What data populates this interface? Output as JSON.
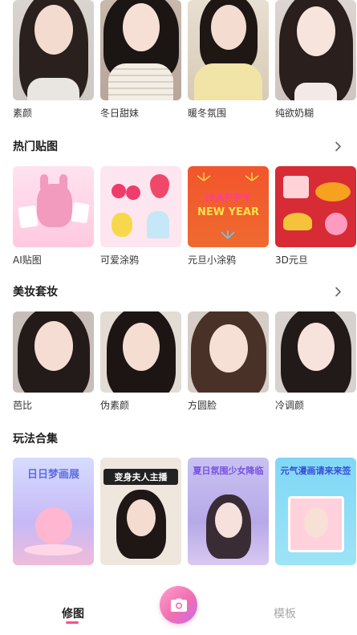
{
  "top_row": {
    "items": [
      {
        "label": "素颜"
      },
      {
        "label": "冬日甜妹"
      },
      {
        "label": "暖冬氛围"
      },
      {
        "label": "纯欲奶糊"
      }
    ]
  },
  "hot_stickers": {
    "title": "热门贴图",
    "items": [
      {
        "label": "AI贴图"
      },
      {
        "label": "可爱涂鸦"
      },
      {
        "label": "元旦小涂鸦",
        "overlay_line1": "HAPPY",
        "overlay_line2": "NEW YEAR"
      },
      {
        "label": "3D元旦"
      }
    ]
  },
  "makeup": {
    "title": "美妆套妆",
    "items": [
      {
        "label": "芭比"
      },
      {
        "label": "伪素颜"
      },
      {
        "label": "方圆脸"
      },
      {
        "label": "冷调颜"
      }
    ]
  },
  "play": {
    "title": "玩法合集",
    "items": [
      {
        "overlay": "日日梦画展"
      },
      {
        "overlay": "变身夫人主播"
      },
      {
        "overlay": "夏日氛围少女降临"
      },
      {
        "overlay": "元气漫画请来来签"
      }
    ]
  },
  "tabbar": {
    "edit_label": "修图",
    "template_label": "模板"
  },
  "colors": {
    "accent": "#ff4d8d",
    "inactive": "#a8a8a8"
  }
}
